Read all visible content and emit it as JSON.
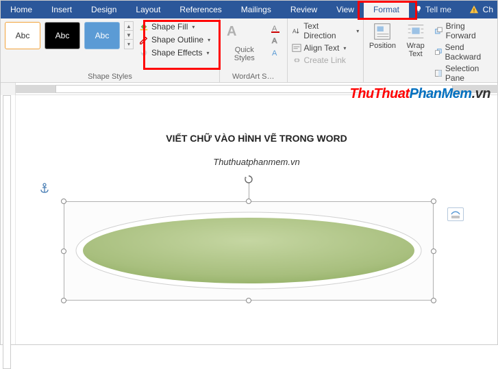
{
  "tabs": {
    "home": "Home",
    "insert": "Insert",
    "design": "Design",
    "layout": "Layout",
    "references": "References",
    "mailings": "Mailings",
    "review": "Review",
    "view": "View",
    "format": "Format"
  },
  "tell_me": "Tell me",
  "title_right": "Ch",
  "ribbon": {
    "shape_styles": {
      "label": "Shape Styles",
      "thumb_text": "Abc",
      "fill": "Shape Fill",
      "outline": "Shape Outline",
      "effects": "Shape Effects"
    },
    "wordart": {
      "label": "WordArt S…",
      "quick_styles": "Quick Styles"
    },
    "text": {
      "direction": "Text Direction",
      "align": "Align Text",
      "link": "Create Link"
    },
    "arrange": {
      "position": "Position",
      "wrap": "Wrap Text",
      "bring_forward": "Bring Forward",
      "send_backward": "Send Backward",
      "selection_pane": "Selection Pane"
    }
  },
  "watermark": {
    "p1": "ThuThuat",
    "p2": "PhanMem",
    "p3": ".vn"
  },
  "document": {
    "title": "VIẾT CHỮ VÀO HÌNH VẼ TRONG WORD",
    "subtitle": "Thuthuatphanmem.vn"
  }
}
